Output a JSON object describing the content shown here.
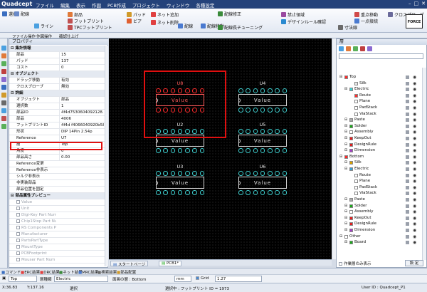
{
  "app": {
    "title": "Quadcept",
    "menu": [
      "ファイル",
      "編集",
      "表示",
      "作図",
      "PCB作成",
      "プロジェクト",
      "ウィンドウ",
      "各種設定"
    ]
  },
  "ribbon": {
    "buttons": [
      "選択",
      "配線",
      "ライン",
      "部品",
      "フットプリント",
      "TPCフットプリント",
      "パッド",
      "ビア",
      "ネット追加",
      "ネット削除",
      "配線",
      "配線移動",
      "配線修正",
      "配線長チューニング",
      "禁止領域",
      "デザインルール確認",
      "寸法線",
      "重点移動",
      "一点接続",
      "クロスプローブ"
    ],
    "tabs": [
      "ファイル操作",
      "作図操作",
      "確認仕上げ"
    ],
    "force": "FORCE"
  },
  "properties": {
    "title": "プロパティ",
    "rows": [
      {
        "k": "集計情報",
        "v": "",
        "type": "sect"
      },
      {
        "k": "部品",
        "v": "15"
      },
      {
        "k": "パッド",
        "v": "137"
      },
      {
        "k": "コスト",
        "v": "0"
      },
      {
        "k": "オブジェクト",
        "v": "",
        "type": "sect"
      },
      {
        "k": "ドラッグ移動",
        "v": "有効"
      },
      {
        "k": "クロスプローブ",
        "v": "無効"
      },
      {
        "k": "詳細",
        "v": "",
        "type": "sect"
      },
      {
        "k": "オブジェクト",
        "v": "部品"
      },
      {
        "k": "選択数",
        "v": "1"
      },
      {
        "k": "部品ID",
        "v": "4f4d7530604092128..."
      },
      {
        "k": "部品",
        "v": "4006"
      },
      {
        "k": "フットプリントID",
        "v": "4f4d f4066040920b587"
      },
      {
        "k": "形状",
        "v": "DIP 14Pin 2.54p"
      },
      {
        "k": "Reference",
        "v": "U7"
      },
      {
        "k": "層",
        "v": "Top"
      },
      {
        "k": "角度",
        "v": "0"
      },
      {
        "k": "部品高さ",
        "v": "0.00"
      },
      {
        "k": "Reference変更",
        "v": ""
      },
      {
        "k": "Reference非表示",
        "v": ""
      },
      {
        "k": "シルク非表示",
        "v": ""
      },
      {
        "k": "非実装部品",
        "v": ""
      },
      {
        "k": "部品位置を固定",
        "v": ""
      },
      {
        "k": "部品属性プレビュー",
        "v": "",
        "type": "sect"
      },
      {
        "k": "Value",
        "v": "",
        "type": "gray"
      },
      {
        "k": "Unit",
        "v": "",
        "type": "gray"
      },
      {
        "k": "Digi-Key Part Num",
        "v": "",
        "type": "gray"
      },
      {
        "k": "Chip1Stop Part Nu",
        "v": "",
        "type": "gray"
      },
      {
        "k": "RS Components P",
        "v": "",
        "type": "gray"
      },
      {
        "k": "Manufacturer",
        "v": "",
        "type": "gray"
      },
      {
        "k": "PartsPartType",
        "v": "",
        "type": "gray"
      },
      {
        "k": "MountType",
        "v": "",
        "type": "gray"
      },
      {
        "k": "PCBFootprint",
        "v": "",
        "type": "gray"
      },
      {
        "k": "Mouser Part Num",
        "v": "",
        "type": "gray"
      }
    ]
  },
  "canvas": {
    "components": [
      {
        "ref": "U8",
        "value": "Value",
        "selected": true
      },
      {
        "ref": "U4",
        "value": "Value",
        "selected": false
      },
      {
        "ref": "U2",
        "value": "Value",
        "selected": false
      },
      {
        "ref": "U5",
        "value": "Value",
        "selected": false
      },
      {
        "ref": "U3",
        "value": "Value",
        "selected": false
      },
      {
        "ref": "U6",
        "value": "Value",
        "selected": false
      }
    ]
  },
  "layers": {
    "title": "層",
    "items": [
      {
        "name": "Top",
        "indent": 0,
        "color": "#ff2a2a"
      },
      {
        "name": "Silk",
        "indent": 2,
        "color": "#e6e6e6"
      },
      {
        "name": "Electric",
        "indent": 1,
        "color": "#3ecfcf"
      },
      {
        "name": "Route",
        "indent": 2,
        "color": "#ff3030"
      },
      {
        "name": "Plane",
        "indent": 2,
        "color": "#ffffff"
      },
      {
        "name": "PadStack",
        "indent": 2,
        "color": "#ffffff"
      },
      {
        "name": "ViaStack",
        "indent": 2,
        "color": "#ffffff"
      },
      {
        "name": "Paste",
        "indent": 1,
        "color": "#aaaaaa"
      },
      {
        "name": "Solder",
        "indent": 1,
        "color": "#1da81d"
      },
      {
        "name": "Assembly",
        "indent": 1,
        "color": "#ffffff"
      },
      {
        "name": "KeepOut",
        "indent": 1,
        "color": "#e02020"
      },
      {
        "name": "DesignRule",
        "indent": 1,
        "color": "#e02020"
      },
      {
        "name": "Dimension",
        "indent": 1,
        "color": "#a040c0"
      },
      {
        "name": "Bottom",
        "indent": 0,
        "color": "#ff2a2a"
      },
      {
        "name": "Silk",
        "indent": 1,
        "color": "#d8a000"
      },
      {
        "name": "Electric",
        "indent": 1,
        "color": "#3e9fcf"
      },
      {
        "name": "Route",
        "indent": 2,
        "color": "#ffffff"
      },
      {
        "name": "Plane",
        "indent": 2,
        "color": "#ffffff"
      },
      {
        "name": "PadStack",
        "indent": 2,
        "color": "#ffffff"
      },
      {
        "name": "ViaStack",
        "indent": 2,
        "color": "#ffffff"
      },
      {
        "name": "Paste",
        "indent": 1,
        "color": "#aaaaaa"
      },
      {
        "name": "Solder",
        "indent": 1,
        "color": "#1da81d"
      },
      {
        "name": "Assembly",
        "indent": 1,
        "color": "#ffffff"
      },
      {
        "name": "KeepOut",
        "indent": 1,
        "color": "#e02020"
      },
      {
        "name": "DesignRule",
        "indent": 1,
        "color": "#e02020"
      },
      {
        "name": "Dimension",
        "indent": 1,
        "color": "#a040c0"
      },
      {
        "name": "Other",
        "indent": 0,
        "color": "#ffffff"
      },
      {
        "name": "Board",
        "indent": 1,
        "color": "#1da81d"
      }
    ],
    "footer_checkbox": "作業層のみ表示",
    "footer_button": "設 定"
  },
  "doc_tabs": [
    "スタートページ",
    "PCB1*"
  ],
  "cmd_tabs": [
    "コマンド",
    "ERC結果",
    "DRC結果",
    "ネット結果",
    "MRC結果",
    "検索結果",
    "部品配置"
  ],
  "options": {
    "layer": "Top",
    "pen_label": "層種類",
    "pen": "Electric",
    "face_label": "面画の層 : Bottom",
    "unit": "mm",
    "grid_label": "Grid",
    "grid": "1.27"
  },
  "status": {
    "coord_x": "X:36.83",
    "coord_y": "Y:137.16",
    "mode": "選択",
    "selection": "選択中 : フットプリント ID = 1973",
    "user": "User ID : Quadcept_P1"
  }
}
